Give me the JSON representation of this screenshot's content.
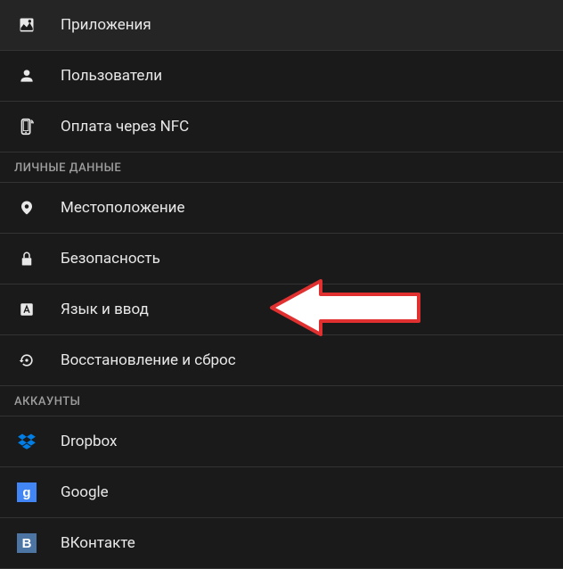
{
  "items": {
    "apps": {
      "label": "Приложения"
    },
    "users": {
      "label": "Пользователи"
    },
    "nfc": {
      "label": "Оплата через NFC"
    },
    "location": {
      "label": "Местоположение"
    },
    "security": {
      "label": "Безопасность"
    },
    "language": {
      "label": "Язык и ввод"
    },
    "backup": {
      "label": "Восстановление и сброс"
    },
    "dropbox": {
      "label": "Dropbox"
    },
    "google": {
      "label": "Google",
      "letter": "g"
    },
    "vk": {
      "label": "ВКонтакте",
      "letter": "В"
    }
  },
  "sections": {
    "personal": {
      "label": "ЛИЧНЫЕ ДАННЫЕ"
    },
    "accounts": {
      "label": "АККАУНТЫ"
    }
  }
}
